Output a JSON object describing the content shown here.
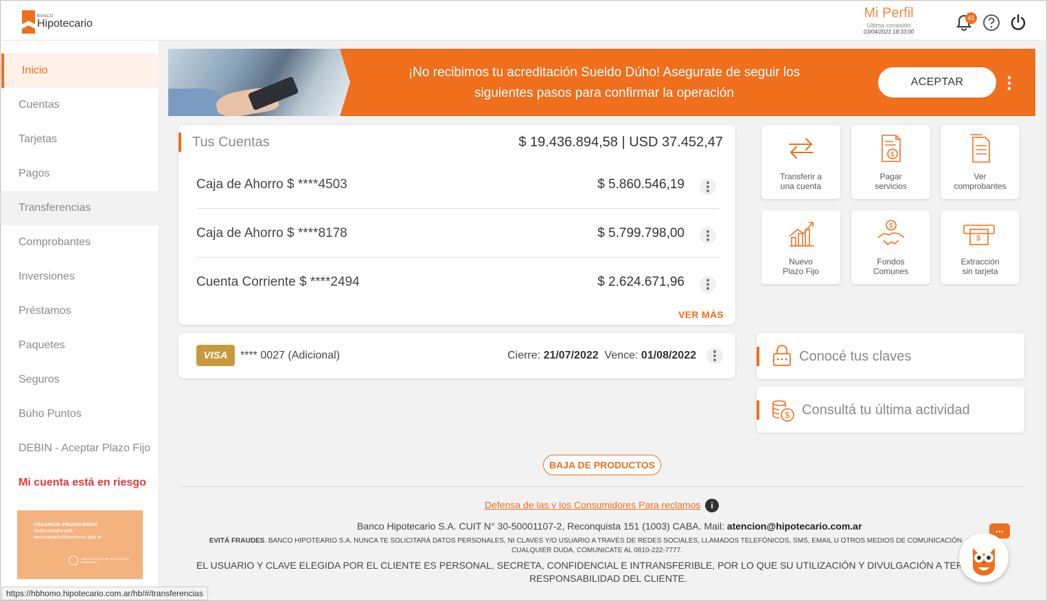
{
  "header": {
    "logo_small": "BANCO",
    "logo_name": "Hipotecario",
    "profile_name": "Mi Perfil",
    "last_login_label": "Última conexión",
    "last_login_date": "03/04/2023 18:33:00",
    "notification_count": "41"
  },
  "sidebar": {
    "items": [
      {
        "label": "Inicio"
      },
      {
        "label": "Cuentas"
      },
      {
        "label": "Tarjetas"
      },
      {
        "label": "Pagos"
      },
      {
        "label": "Transferencias"
      },
      {
        "label": "Comprobantes"
      },
      {
        "label": "Inversiones"
      },
      {
        "label": "Préstamos"
      },
      {
        "label": "Paquetes"
      },
      {
        "label": "Seguros"
      },
      {
        "label": "Búho Puntos"
      },
      {
        "label": "DEBIN - Aceptar Plazo Fijo"
      },
      {
        "label": "Mi cuenta está en riesgo"
      }
    ],
    "banner": {
      "title": "USUARIOS FINANCIEROS",
      "line1": "Visitá nuestra web",
      "line2": "www.usuariosfinancieros.gob.ar",
      "seal_text": "BANCO CENTRAL DE LA REPUBLICA ARGENTINA"
    }
  },
  "promo": {
    "message": "¡No recibimos tu acreditación Sueldo Dúho! Asegurate de seguir los siguientes pasos para confirmar la operación",
    "button": "ACEPTAR"
  },
  "accounts": {
    "title": "Tus Cuentas",
    "total": "$ 19.436.894,58 | USD 37.452,47",
    "rows": [
      {
        "name": "Caja de Ahorro $ ****4503",
        "amount": "$ 5.860.546,19"
      },
      {
        "name": "Caja de Ahorro $ ****8178",
        "amount": "$ 5.799.798,00"
      },
      {
        "name": "Cuenta Corriente $ ****2494",
        "amount": "$ 2.624.671,96"
      }
    ],
    "more": "VER MÁS"
  },
  "card": {
    "brand": "VISA",
    "number": "**** 0027 (Adicional)",
    "close_label": "Cierre:",
    "close_date": "21/07/2022",
    "due_label": "Vence:",
    "due_date": "01/08/2022"
  },
  "quick_actions": [
    {
      "line1": "Transferir a",
      "line2": "una cuenta",
      "icon": "transfer-icon"
    },
    {
      "line1": "Pagar",
      "line2": "servicios",
      "icon": "pay-services-icon"
    },
    {
      "line1": "Ver",
      "line2": "comprobantes",
      "icon": "receipts-icon"
    },
    {
      "line1": "Nuevo",
      "line2": "Plazo Fijo",
      "icon": "growth-chart-icon"
    },
    {
      "line1": "Fondos",
      "line2": "Comunes",
      "icon": "handshake-icon"
    },
    {
      "line1": "Extracción",
      "line2": "sin tarjeta",
      "icon": "atm-icon"
    }
  ],
  "info_cards": [
    {
      "label": "Conocé tus claves",
      "icon": "lock-icon"
    },
    {
      "label": "Consultá tu última actividad",
      "icon": "coins-icon"
    }
  ],
  "footer": {
    "baja": "BAJA DE PRODUCTOS",
    "defensa": "Defensa de las y los Consumidores Para reclamos ",
    "info": "i",
    "company": "Banco Hipotecario S.A. CUIT N° 30-50001107-2, Reconquista 151 (1003) CABA. Mail: ",
    "email": "atencion@hipotecario.com.ar",
    "fraude_bold": "EVITÁ FRAUDES",
    "fraude_text": ". BANCO HIPOTEARIO S.A. NUNCA TE SOLICITARÁ DATOS PERSONALES, NI CLAVES Y/O USUARIO A TRAVÉS DE REDES SOCIALES, LLAMADOS TELEFÓNICOS, SMS, EMAIL U OTROS MEDIOS DE COMUNICACIÓN",
    "fraude_line2": "CUALQUIER DUDA, COMUNICATE AL 0810-222-7777.",
    "legal_line1": "EL USUARIO Y CLAVE ELEGIDA POR EL CLIENTE ES PERSONAL, SECRETA, CONFIDENCIAL E INTRANSFERIBLE, POR LO QUE SU UTILIZACIÓN Y DIVULGACIÓN A TERCEROS ES DE EXCLUSIVA",
    "legal_line2": "RESPONSABILIDAD DEL CLIENTE."
  },
  "status_url": "https://hbhomo.hipotecario.com.ar/hb/#/transferencias",
  "chat_bubble": "...",
  "colors": {
    "accent": "#ef6f1d",
    "risk": "#e23b3b",
    "visa": "#c69a3d"
  }
}
